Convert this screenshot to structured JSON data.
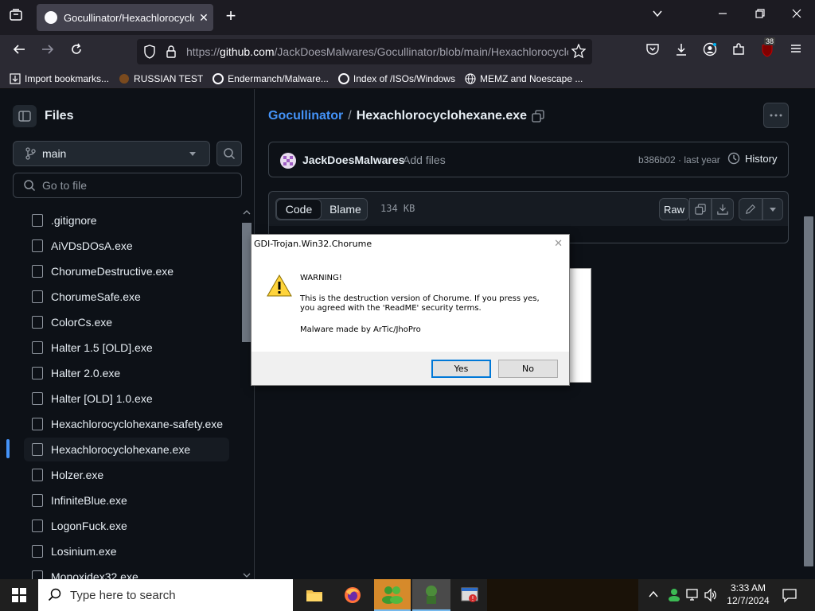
{
  "browser": {
    "tab_title": "Gocullinator/Hexachlorocyclohe",
    "url_prefix": "https://",
    "url_host": "github.com",
    "url_path": "/JackDoesMalwares/Gocullinator/blob/main/Hexachlorocyclo",
    "extension_badge": "38",
    "bookmarks": [
      "Import bookmarks...",
      "RUSSIAN TEST",
      "Endermanch/Malware...",
      "Index of /ISOs/Windows",
      "MEMZ and Noescape ..."
    ]
  },
  "sidebar": {
    "title": "Files",
    "branch": "main",
    "go_to_file_placeholder": "Go to file",
    "files": [
      ".gitignore",
      "AiVDsDOsA.exe",
      "ChorumeDestructive.exe",
      "ChorumeSafe.exe",
      "ColorCs.exe",
      "Halter 1.5 [OLD].exe",
      "Halter 2.0.exe",
      "Halter [OLD] 1.0.exe",
      "Hexachlorocyclohexane-safety.exe",
      "Hexachlorocyclohexane.exe",
      "Holzer.exe",
      "InfiniteBlue.exe",
      "LogonFuck.exe",
      "Losinium.exe",
      "Monoxidex32.exe"
    ],
    "active_file": "Hexachlorocyclohexane.exe"
  },
  "main": {
    "repo": "Gocullinator",
    "separator": "/",
    "file": "Hexachlorocyclohexane.exe",
    "author": "JackDoesMalwares",
    "commit_message": "Add files",
    "commit_info": "b386b02 · last year",
    "history_label": "History",
    "tab_code": "Code",
    "tab_blame": "Blame",
    "size": "134 KB",
    "raw_label": "Raw"
  },
  "dialog": {
    "title": "GDI-Trojan.Win32.Chorume",
    "heading": "WARNING!",
    "message_line1": "This is the destruction version of Chorume. If you press yes,",
    "message_line2": "you agreed with the 'ReadME' security terms.",
    "credit": "Malware made by ArTic/JhoPro",
    "yes_label": "Yes",
    "no_label": "No"
  },
  "taskbar": {
    "search_placeholder": "Type here to search",
    "time": "3:33 AM",
    "date": "12/7/2024"
  },
  "colors": {
    "accent_link": "#4493f8",
    "active_bar": "#4493f8",
    "dialog_default": "#0078d7"
  }
}
